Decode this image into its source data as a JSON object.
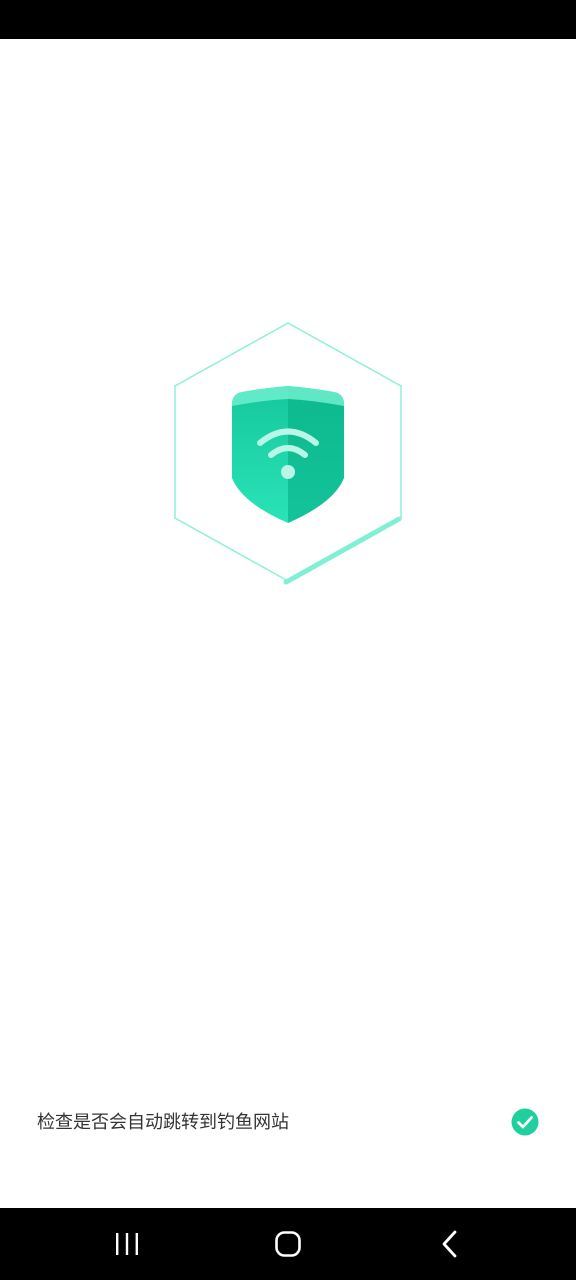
{
  "app": {
    "graphic_icon": "wifi-shield-icon",
    "accent_color": "#1fcf9e"
  },
  "scan": {
    "items": [
      {
        "label": "检查是否会自动跳转到钓鱼网站",
        "status": "done",
        "status_icon": "check-circle-icon"
      }
    ]
  },
  "navigation": {
    "buttons": [
      {
        "icon": "recents-icon"
      },
      {
        "icon": "home-icon"
      },
      {
        "icon": "back-icon"
      }
    ]
  }
}
